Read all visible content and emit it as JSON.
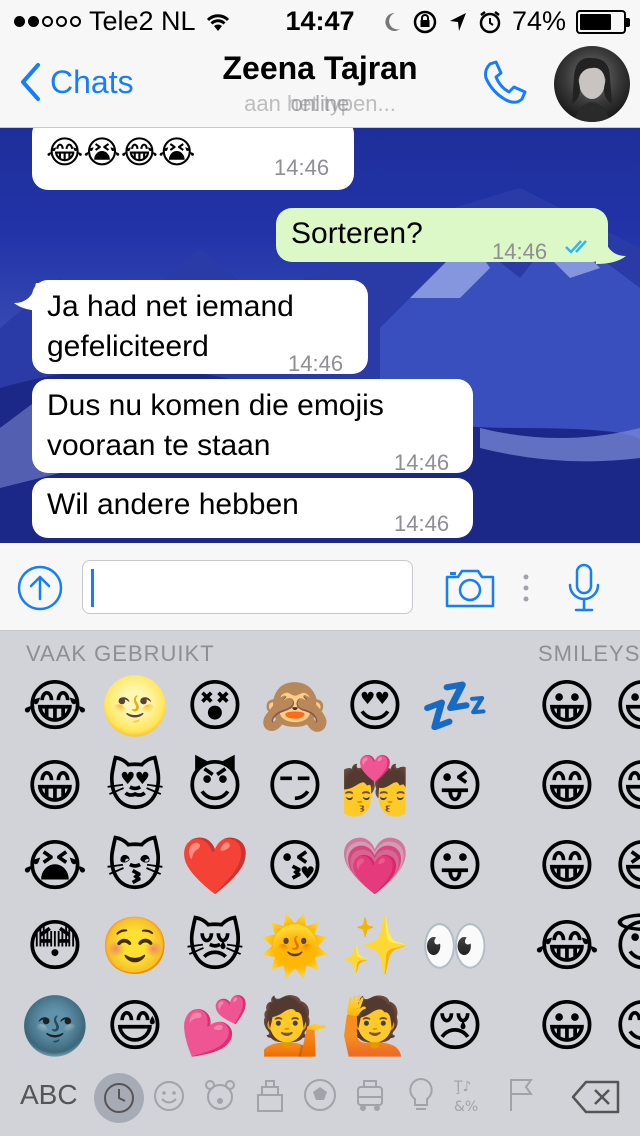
{
  "status": {
    "carrier": "Tele2 NL",
    "time": "14:47",
    "battery": "74%",
    "battery_level": 0.74,
    "signal_bars": 2,
    "icons": [
      "wifi-icon",
      "moon-icon",
      "rotation-lock-icon",
      "location-icon",
      "alarm-icon"
    ]
  },
  "nav": {
    "back_label": "Chats",
    "contact_name": "Zeena Tajran",
    "subtitle": "aan het typen...",
    "subtitle_overlay": "online"
  },
  "messages": [
    {
      "dir": "in",
      "text": "😂😭😂😭",
      "time": "14:46"
    },
    {
      "dir": "out",
      "text": "Sorteren?",
      "time": "14:46",
      "read": true
    },
    {
      "dir": "in",
      "lines": [
        "Ja had net iemand",
        "gefeliciteerd"
      ],
      "time": "14:46"
    },
    {
      "dir": "in",
      "lines": [
        "Dus nu komen die emojis",
        "vooraan te staan"
      ],
      "time": "14:46"
    },
    {
      "dir": "in",
      "lines": [
        "Wil andere hebben"
      ],
      "time": "14:46"
    }
  ],
  "keyboard": {
    "section_recent": "VAAK GEBRUIKT",
    "section_smileys": "SMILEYS",
    "recent_rows": [
      [
        "😂",
        "🌝",
        "😵",
        "🙈",
        "😍",
        "💤"
      ],
      [
        "😁",
        "😻",
        "😈",
        "😏",
        "💏",
        "😜"
      ],
      [
        "😭",
        "😽",
        "❤️",
        "😘",
        "💗",
        "😛"
      ],
      [
        "😳",
        "☺️",
        "😿",
        "🌞",
        "✨",
        "👀"
      ],
      [
        "🌚",
        "😅",
        "💕",
        "💁",
        "🙋",
        "😢"
      ]
    ],
    "smiley_col": [
      "😀",
      "😁",
      "😁",
      "😂",
      "😀"
    ],
    "smiley_col_partial": [
      "😃",
      "😄",
      "😆",
      "😇",
      "😊"
    ],
    "abc_label": "ABC",
    "categories": [
      "recent-icon",
      "smiley-icon",
      "animal-icon",
      "food-icon",
      "sports-icon",
      "travel-icon",
      "objects-icon",
      "symbols-icon",
      "flag-icon"
    ]
  }
}
